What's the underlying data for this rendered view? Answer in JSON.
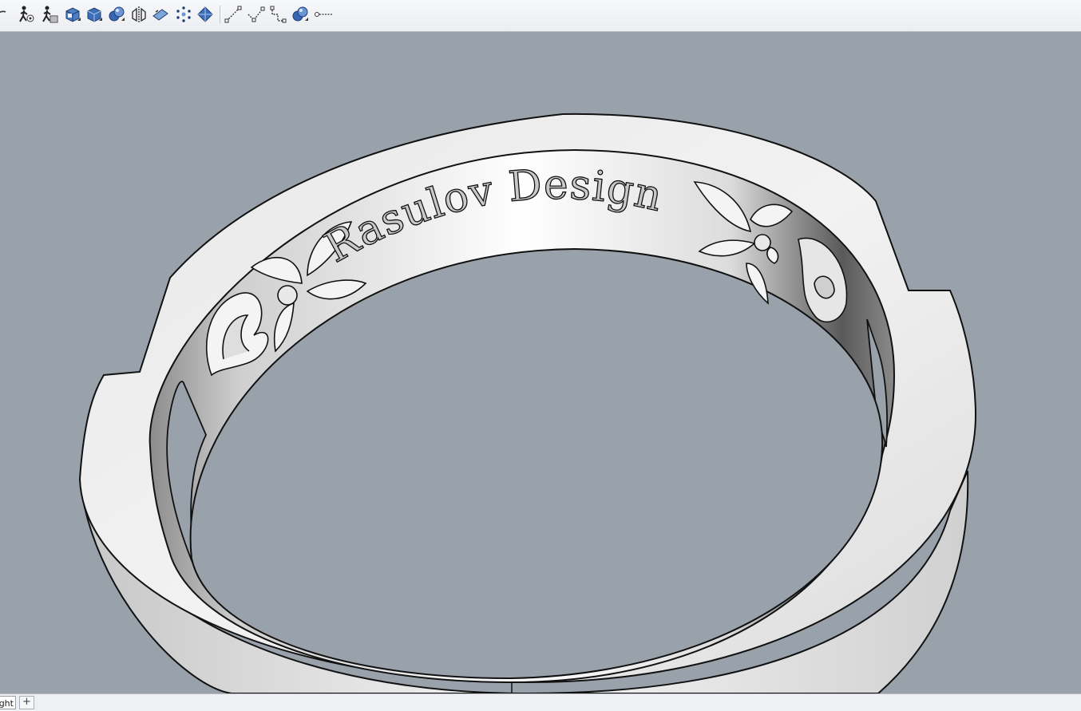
{
  "toolbar": {
    "tools": [
      {
        "name": "partial-arc-icon"
      },
      {
        "name": "walkthrough-icon"
      },
      {
        "name": "walkthrough-settings-icon"
      },
      {
        "name": "box-icon"
      },
      {
        "name": "box-solid-icon"
      },
      {
        "name": "spheres-icon"
      },
      {
        "name": "mirror-icon"
      },
      {
        "name": "plane-icon"
      },
      {
        "name": "points-icon"
      },
      {
        "name": "surface-icon"
      },
      {
        "name": "line-icon"
      },
      {
        "name": "polyline-icon"
      },
      {
        "name": "dimension-icon"
      },
      {
        "name": "render-spheres-icon"
      },
      {
        "name": "truncated-tool-icon"
      }
    ]
  },
  "viewport": {
    "engraving_text": "Rasulov Design"
  },
  "statusbar": {
    "view_tab_label": "Right",
    "add_tab_label": "+"
  }
}
